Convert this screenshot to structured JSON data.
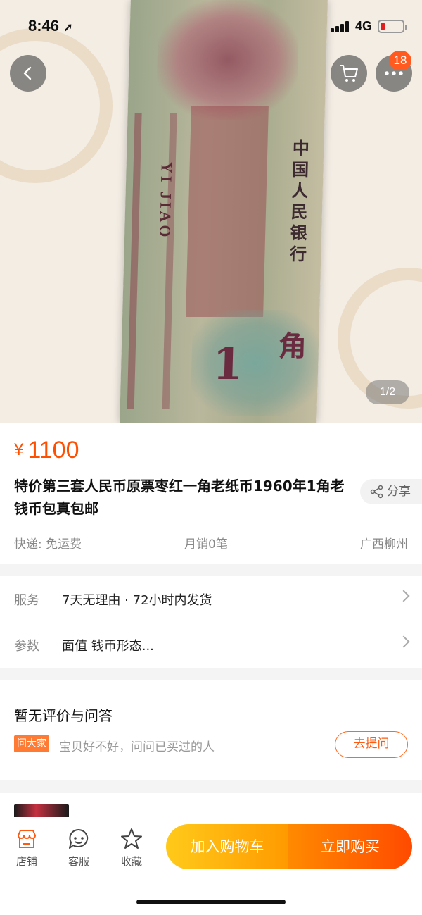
{
  "status": {
    "time": "8:46",
    "network": "4G"
  },
  "gallery": {
    "pager": "1/2",
    "cart_badge": "18",
    "note_vertical_text": "YI JIAO",
    "note_cn_text": "中国人民银行",
    "note_big_number": "1",
    "note_jiao": "角"
  },
  "product": {
    "currency": "¥",
    "price": "1100",
    "title": "特价第三套人民币原票枣红一角老纸币1960年1角老钱币包真包邮",
    "share_label": "分享",
    "shipping": "快递: 免运费",
    "monthly_sales": "月销0笔",
    "location": "广西柳州"
  },
  "services": [
    {
      "label": "服务",
      "value": "7天无理由 · 72小时内发货"
    },
    {
      "label": "参数",
      "value": "面值 钱币形态..."
    }
  ],
  "reviews": {
    "title": "暂无评价与问答",
    "ask_tag": "问大家",
    "ask_text": "宝贝好不好，问问已买过的人",
    "ask_button": "去提问"
  },
  "bottom_bar": {
    "shop_label": "店铺",
    "service_label": "客服",
    "favorite_label": "收藏",
    "add_cart_label": "加入购物车",
    "buy_now_label": "立即购买"
  },
  "colors": {
    "accent": "#ff4f00",
    "cart_gradient": [
      "#ffca1a",
      "#ff9a00"
    ],
    "buy_gradient": [
      "#ff8a00",
      "#ff4a00"
    ]
  }
}
